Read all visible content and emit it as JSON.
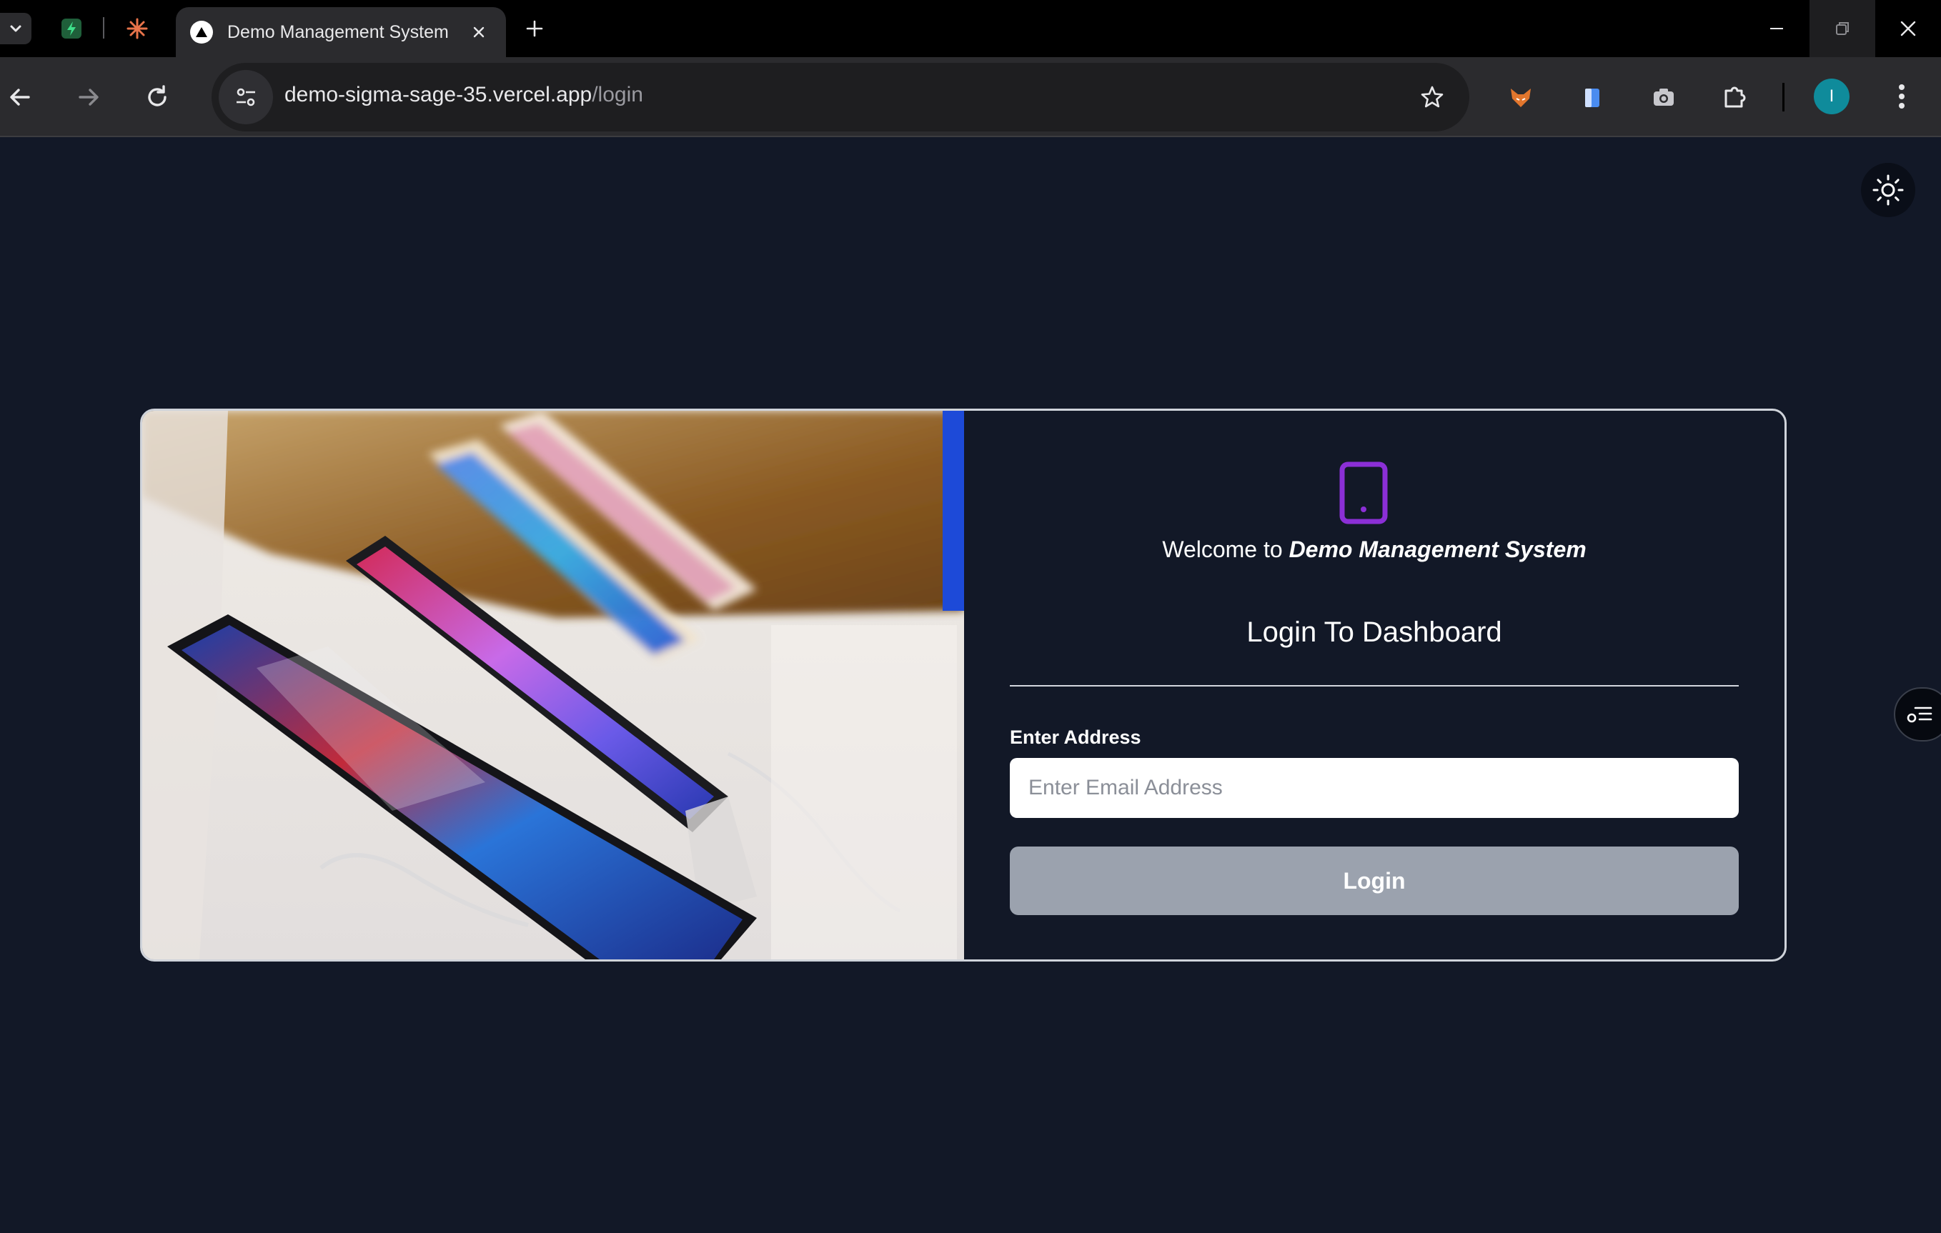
{
  "browser": {
    "active_tab_title": "Demo Management System",
    "address": {
      "host": "demo-sigma-sage-35.vercel.app",
      "path": "/login"
    },
    "profile_initial": "I",
    "avatar_color": "#0f8b9b"
  },
  "page": {
    "welcome_prefix": "Welcome to ",
    "welcome_app_name": "Demo Management System",
    "heading": "Login To Dashboard",
    "email_label": "Enter Address",
    "email_placeholder": "Enter Email Address",
    "email_value": "",
    "login_button": "Login",
    "accent_color": "#8b2fd6",
    "background_color": "#121827",
    "button_color": "#9ba2ae"
  }
}
